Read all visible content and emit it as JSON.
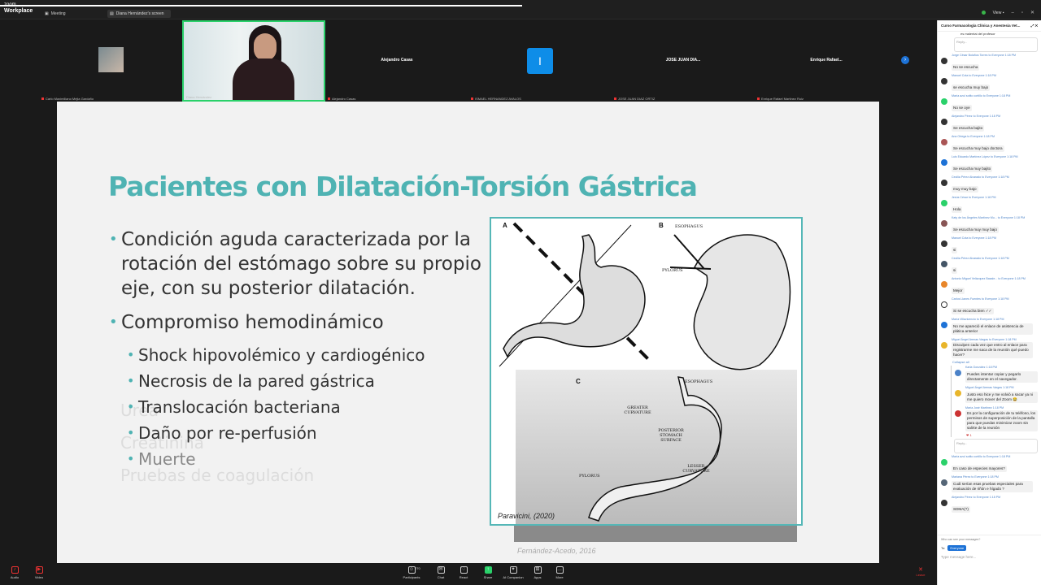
{
  "app": {
    "brand_top": "zoom",
    "brand_bottom": "Workplace",
    "meeting_tab": "Meeting",
    "share_tab": "Diana Hernández's screen",
    "view_label": "View"
  },
  "gallery": {
    "tiles": [
      {
        "name": "",
        "label": "Carlo Maximiliano Mejia Gardaño"
      },
      {
        "name": "",
        "label": "Diana Hernández"
      },
      {
        "name": "Alejandro Casas",
        "label": "Alejandro Casas"
      },
      {
        "name": "",
        "label": "ISMAEL HERNANDEZ AVALOS"
      },
      {
        "name": "JOSE JUAN DIA...",
        "label": "JOSE JUAN DIAZ ORTIZ"
      },
      {
        "name": "Enrique Rafael...",
        "label": "Enrique Rafael Martinez Ruiz"
      }
    ],
    "blue_tile_letter": "I"
  },
  "slide": {
    "title": "Pacientes con Dilatación-Torsión Gástrica",
    "bullet1": "Condición aguda caracterizada por la rotación del estómago sobre su propio eje, con su posterior dilatación.",
    "bullet2": "Compromiso hemodinámico",
    "sub": [
      "Shock hipovolémico y cardiogénico",
      "Necrosis de la pared gástrica",
      "Translocación bacteriana",
      "Daño por re-perfusión",
      "Muerte"
    ],
    "ghost": [
      "Urea",
      "Creatinina",
      "Pruebas de coagulación"
    ],
    "figure": {
      "letters": [
        "A",
        "B",
        "C"
      ],
      "labels_b": [
        "ESOPHAGUS",
        "PYLORUS"
      ],
      "labels_c": [
        "ESOPHAGUS",
        "GREATER CURVATURE",
        "POSTERIOR STOMACH SURFACE",
        "LESSER CURVATURE",
        "PYLORUS"
      ],
      "credit": "Paravicini, (2020)"
    },
    "credit2": "Fernández-Acedo, 2016"
  },
  "chat": {
    "title": "Curso Farmacología Clínica y Anestesia Vet...",
    "top_text": "es malentai del profesor",
    "reply": "Reply...",
    "messages": [
      {
        "who": "Jorge César Bolaños Torres to Everyone 1:18 PM",
        "text": "No se escucha"
      },
      {
        "who": "Manuel Cota to Everyone 1:18 PM",
        "text": "se escucha muy bajo"
      },
      {
        "who": "María azul sotito cortillo to Everyone 1:18 PM",
        "text": "No se oye"
      },
      {
        "who": "Alejandro Pérez to Everyone 1:18 PM",
        "text": "Se escucha bajito"
      },
      {
        "who": "Ana Ortega to Everyone 1:18 PM",
        "text": "Se escucha muy bajo doctora"
      },
      {
        "who": "Luis Eduardo Martínez López to Everyone 1:18 PM",
        "text": "Se escucha muy bajito"
      },
      {
        "who": "Cecilia Pérez Alvarado to Everyone 1:18 PM",
        "text": "muy muy bajo"
      },
      {
        "who": "Jesús César to Everyone 1:18 PM",
        "text": "Hola"
      },
      {
        "who": "Katy de los Ángeles Martínez Mu... to Everyone 1:18 PM",
        "text": "Se escucha muy muy bajo"
      },
      {
        "who": "Manuel Cota to Everyone 1:18 PM",
        "text": "si"
      },
      {
        "who": "Cecilia Pérez Alvarado to Everyone 1:18 PM",
        "text": "si"
      },
      {
        "who": "Antonio Miguel Velázquez Basale... to Everyone 1:18 PM",
        "text": "Mejor"
      },
      {
        "who": "Carlos Llanes Fuentes to Everyone 1:18 PM",
        "text": "Si se escucha bien ✓✓"
      },
      {
        "who": "María Villavicencio to Everyone 1:18 PM",
        "text": "No me apareció el enlace de asistencia de plática anterior"
      },
      {
        "who": "Miguel Ángel Arenas Vargas to Everyone 1:18 PM",
        "text": "Disculpen cada vez que entro al enlace para registrarme me saca de la reunión qué puedo hacer?"
      }
    ],
    "collapse_label": "Collapse all",
    "thread": [
      {
        "who": "Karla González 1:18 PM",
        "text": "Puedes intentar copiar y pegarlo directamente en el navegador."
      },
      {
        "who": "Miguel Ángel Arenas Vargas 1:18 PM",
        "text": "Justo eso hice y me volvió a sacar ya ni me quiero mover del Zoom 😂"
      },
      {
        "who": "María José Martínez 1:18 PM",
        "text": "Es por la configuración de tu teléfono, los permisos de superposición de la pantalla para que puedas minimizar zoom sin salirte de la reunión"
      }
    ],
    "reaction": "❤ 1",
    "after": [
      {
        "who": "María azul sotito cortillo to Everyone 1:18 PM",
        "text": "En caso de especies mayores?"
      },
      {
        "who": "Mariana Pérez to Everyone 1:18 PM",
        "text": "Cuál serían esas pruebas especiales para evaluación de riñón e hígado ?"
      },
      {
        "who": "Alejandro Pérez to Everyone 1:18 PM",
        "text": "SDMA(?)"
      }
    ],
    "who_can_see": "Who can see your messages?",
    "to_label": "To:",
    "everyone": "Everyone",
    "input_placeholder": "Type message here..."
  },
  "toolbar": {
    "audio": "Audio",
    "video": "Video",
    "participants": "Participants",
    "participant_count": "270",
    "chat": "Chat",
    "react": "React",
    "share": "Share",
    "companion": "AI Companion",
    "apps": "Apps",
    "more": "More",
    "leave": "Leave"
  }
}
